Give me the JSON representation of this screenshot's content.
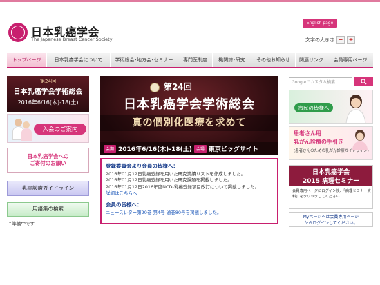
{
  "header": {
    "title": "日本乳癌学会",
    "subtitle": "The Japanese Breast Cancer Society",
    "english_label": "English page",
    "fontsize_label": "文字の大きさ",
    "fontsize_minus": "−",
    "fontsize_plus": "+"
  },
  "nav": {
    "items": [
      {
        "label": "トップページ"
      },
      {
        "label": "日本乳癌学会について"
      },
      {
        "label": "学術総会･地方会･セミナー"
      },
      {
        "label": "専門医制度"
      },
      {
        "label": "機関誌･研究"
      },
      {
        "label": "その他お知らせ"
      },
      {
        "label": "関連リンク"
      },
      {
        "label": "会員専用ページ"
      }
    ]
  },
  "sidebar": {
    "congress_small": {
      "edition": "第24回",
      "title": "日本乳癌学会学術総会",
      "date": "2016年6/16(木)-18(土)"
    },
    "join_label": "入会のご案内",
    "donation_line1": "日本乳癌学会への",
    "donation_line2": "ご寄付のお願い",
    "guideline_label": "乳癌診療ガイドライン",
    "glossary_label": "用語集の検索",
    "prep_note": "↑準備中です"
  },
  "main_banner": {
    "edition": "第24回",
    "title": "日本乳癌学会学術総会",
    "tagline": "真の個別化医療を求めて",
    "period_tag": "会期",
    "date": "2016年6/16(木)-18(土)",
    "venue_tag": "会場",
    "venue": "東京ビッグサイト"
  },
  "news": {
    "heading1": "登録委員会より会員の皆様へ：",
    "lines": [
      "2016年01月12日乳癌登録を用いた研究業績リストを作成しました。",
      "2016年01月12日乳癌登録を用いた研究課題を掲載しました。",
      "2016年01月12日2016年度NCD-乳癌登録項目改訂について掲載しました。"
    ],
    "details_link": "詳細はこちらへ",
    "heading2": "会員の皆様へ：",
    "newsletter": "ニュースレター第20巻 第4号 通巻80号を掲載しました。"
  },
  "right": {
    "search_placeholder": "Google™カスタム検索",
    "citizens_label": "市民の皆様へ",
    "patients_line1": "患者さん用",
    "patients_line2": "乳がん診療の手引き",
    "patients_line3": "(患者さんのための乳がん診療ガイドライン)",
    "seminar_line1": "日本乳癌学会",
    "seminar_line2": "2015 病理セミナー",
    "seminar_desc": "会員専用ページにログイン後、「病理セミナー資料」をクリックしてください",
    "members_line1": "Myページへは会員専用ページ",
    "members_line2": "からログインしてください。"
  },
  "colors": {
    "brand": "#c81f6e",
    "accent": "#d6357a",
    "link": "#1a56b8"
  }
}
